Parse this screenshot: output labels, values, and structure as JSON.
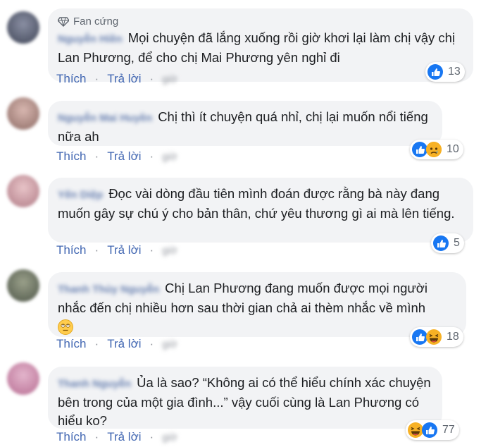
{
  "badge": {
    "label": "Fan cứng"
  },
  "actions": {
    "like": "Thích",
    "reply": "Trả lời",
    "time": "giờ"
  },
  "comments": [
    {
      "name": "Nguyễn Hiền",
      "text": "Mọi chuyện đã lắng xuống rồi giờ khơi lại làm chị vậy chị Lan Phương, để cho chị Mai Phương yên nghỉ đi",
      "reactions": [
        "like-icon"
      ],
      "count": "13"
    },
    {
      "name": "Nguyễn Mai Huyền",
      "text": "Chị thì ít chuyện quá nhỉ, chị lại muốn nổi tiếng nữa ah",
      "reactions": [
        "like-icon",
        "sad-icon"
      ],
      "count": "10"
    },
    {
      "name": "Yến Diệp",
      "text": "Đọc vài dòng đầu tiên mình đoán được rằng bà này đang muốn gây sự chú ý cho bản thân, chứ yêu thương gì ai mà lên tiếng.",
      "reactions": [
        "like-icon"
      ],
      "count": "5"
    },
    {
      "name": "Thanh Thủy Nguyễn",
      "text": "Chị Lan Phương đang muốn được mọi người nhắc đến chị nhiều hơn sau thời gian chả ai thèm nhắc về mình",
      "emoji": "rolling-eyes-emoji",
      "reactions": [
        "like-icon",
        "haha-icon"
      ],
      "count": "18"
    },
    {
      "name": "Thanh Nguyễn",
      "text": "Ủa là sao? “Không ai có thể hiểu chính xác chuyện bên trong của một gia đình...” vậy cuối cùng là Lan Phương có hiểu ko?",
      "reactions": [
        "haha-icon",
        "like-icon"
      ],
      "count": "77"
    }
  ]
}
